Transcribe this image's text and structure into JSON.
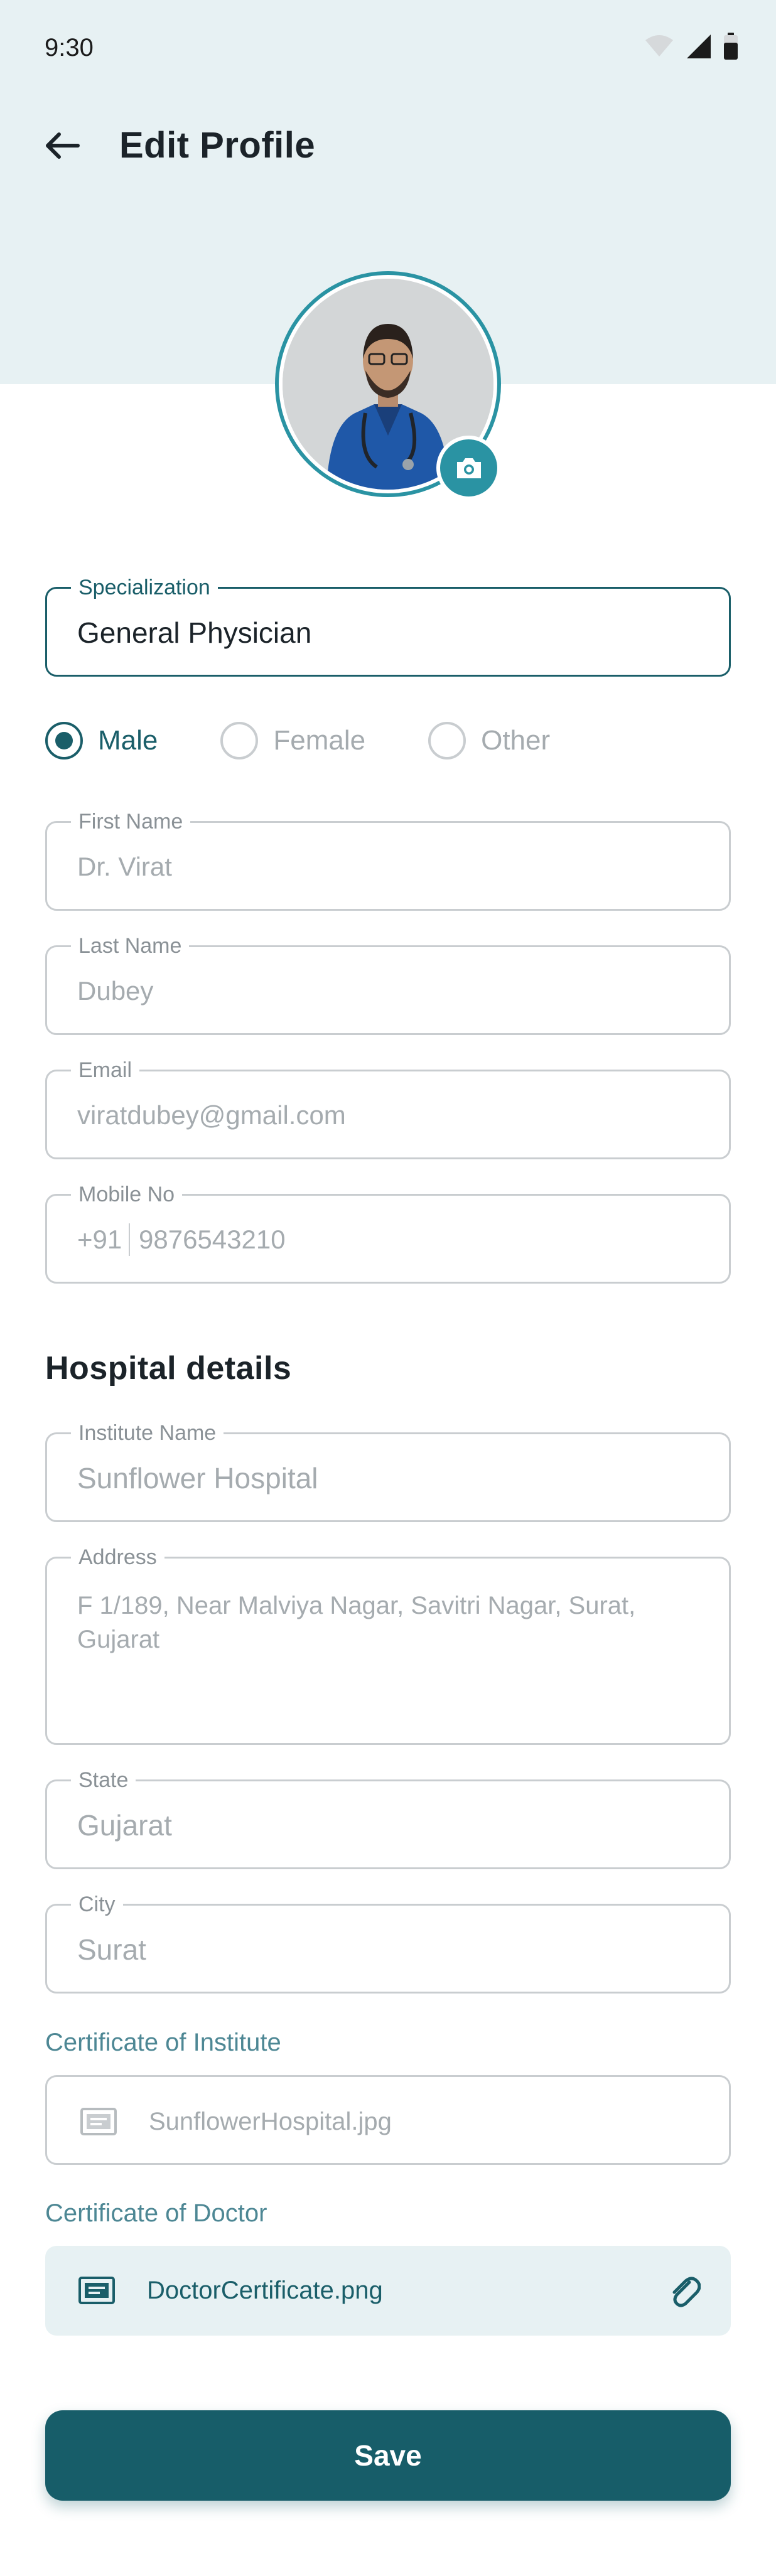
{
  "status_bar": {
    "time": "9:30"
  },
  "header": {
    "title": "Edit Profile"
  },
  "profile": {
    "specialization": {
      "label": "Specialization",
      "value": "General Physician"
    },
    "gender": {
      "options": [
        {
          "label": "Male",
          "selected": true
        },
        {
          "label": "Female",
          "selected": false
        },
        {
          "label": "Other",
          "selected": false
        }
      ]
    },
    "first_name": {
      "label": "First Name",
      "value": "Dr. Virat"
    },
    "last_name": {
      "label": "Last Name",
      "value": "Dubey"
    },
    "email": {
      "label": "Email",
      "value": "viratdubey@gmail.com"
    },
    "mobile": {
      "label": "Mobile No",
      "prefix": "+91",
      "value": "9876543210"
    }
  },
  "hospital": {
    "section_title": "Hospital details",
    "institute_name": {
      "label": "Institute Name",
      "value": "Sunflower Hospital"
    },
    "address": {
      "label": "Address",
      "value": "F 1/189, Near Malviya Nagar, Savitri Nagar, Surat, Gujarat"
    },
    "state": {
      "label": "State",
      "value": "Gujarat"
    },
    "city": {
      "label": "City",
      "value": "Surat"
    },
    "certificate_institute": {
      "label": "Certificate of Institute",
      "file": "SunflowerHospital.jpg"
    },
    "certificate_doctor": {
      "label": "Certificate of Doctor",
      "file": "DoctorCertificate.png"
    }
  },
  "actions": {
    "save_label": "Save"
  },
  "icons": {
    "back": "arrow-left-icon",
    "camera": "camera-icon",
    "file": "certificate-icon",
    "attach": "paperclip-icon",
    "wifi": "wifi-icon",
    "signal": "signal-icon",
    "battery": "battery-icon"
  },
  "colors": {
    "accent": "#175d69",
    "ring": "#2a93a3",
    "header_bg": "#e7f1f3",
    "border": "#c9cdd0",
    "placeholder": "#a5abaf",
    "cert_label": "#4d8794"
  }
}
